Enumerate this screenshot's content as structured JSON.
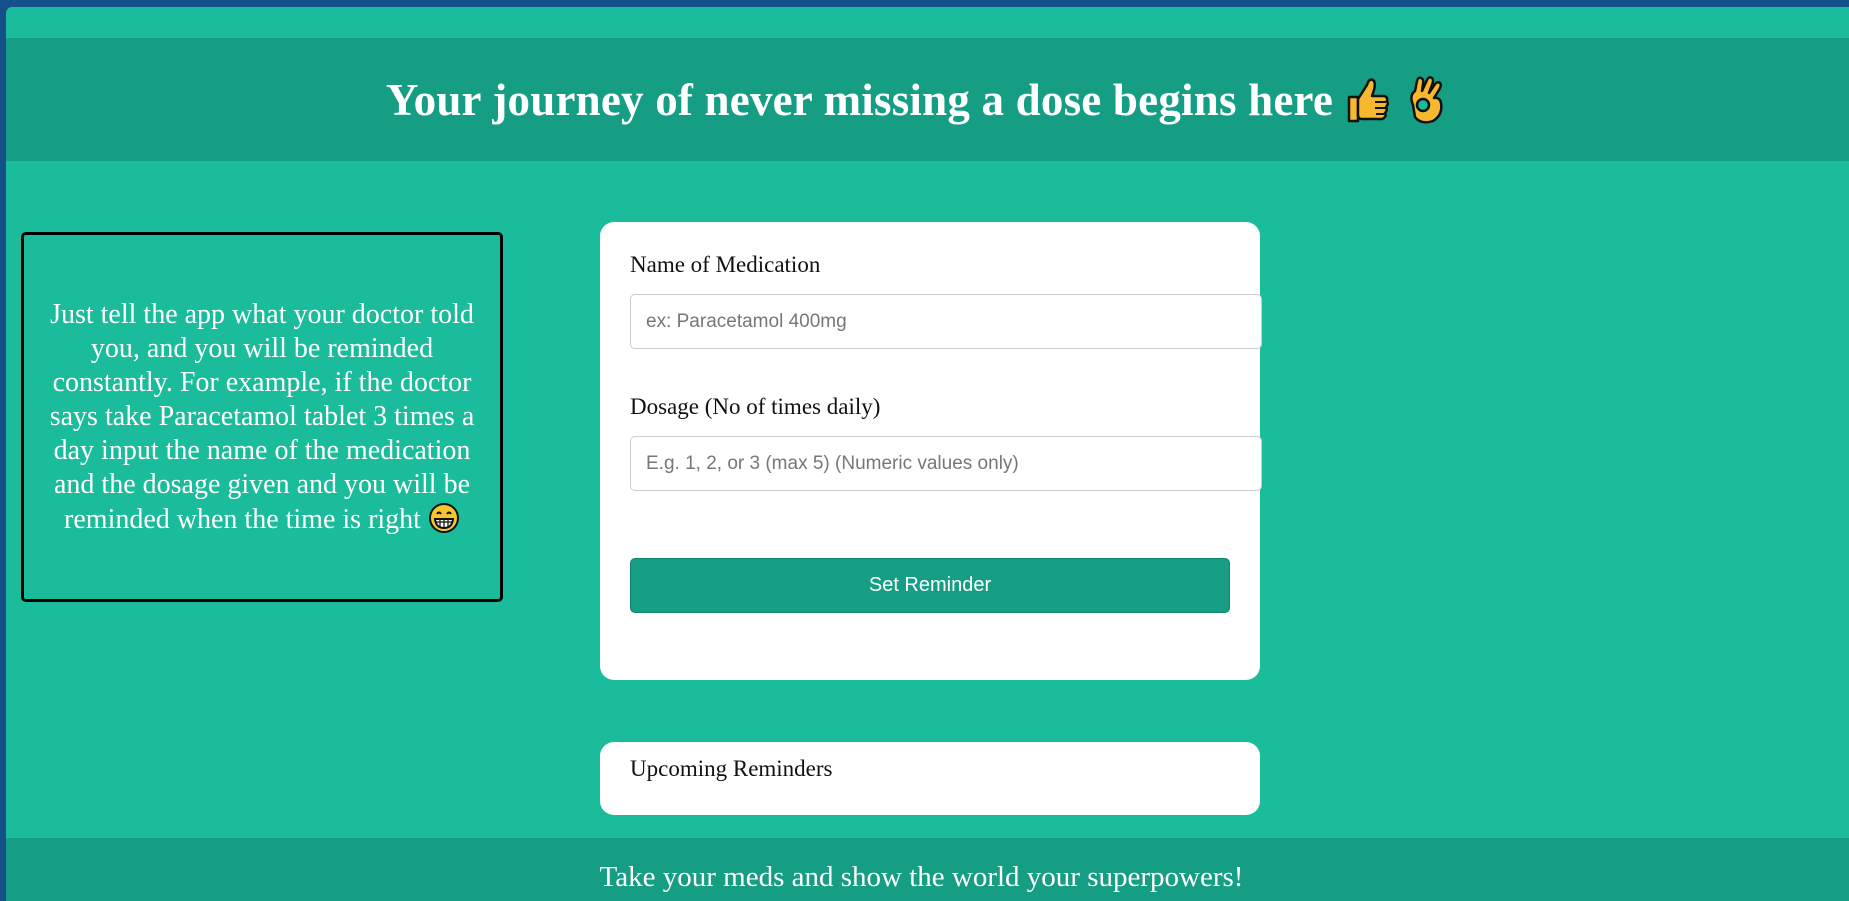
{
  "header": {
    "title": "Your journey of never missing a dose begins here"
  },
  "info": {
    "text": "Just tell the app what your doctor told you, and you will be reminded constantly. For example, if the doctor says take Paracetamol tablet 3 times a day input the name of the medication and the dosage given and you will be reminded when the time is right"
  },
  "form": {
    "medication_label": "Name of Medication",
    "medication_placeholder": "ex: Paracetamol 400mg",
    "medication_value": "",
    "dosage_label": "Dosage (No of times daily)",
    "dosage_placeholder": "E.g. 1, 2, or 3 (max 5) (Numeric values only)",
    "dosage_value": "",
    "submit_label": "Set Reminder"
  },
  "reminders": {
    "title": "Upcoming Reminders"
  },
  "footer": {
    "text": "Take your meds and show the world your superpowers!"
  },
  "icons": {
    "title_icons": [
      "thumbs-up-icon",
      "ok-hand-icon"
    ],
    "info_icon": "grinning-face-icon"
  },
  "colors": {
    "background": "#1bbc9b",
    "header": "#169e84",
    "button": "#169e84",
    "card": "#ffffff"
  }
}
